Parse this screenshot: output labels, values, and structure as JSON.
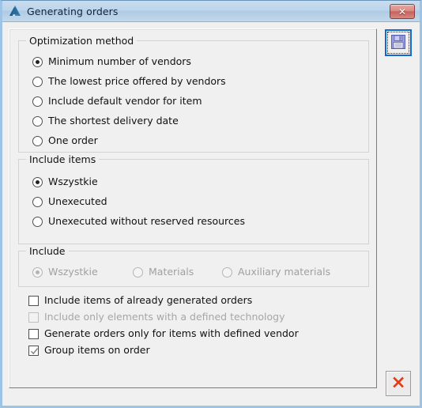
{
  "window": {
    "title": "Generating orders",
    "icon": "mountain-triangle-icon",
    "close_label": "✕",
    "accent_color": "#1367cf",
    "titlebar_color": "#bcd5ea",
    "close_button_color": "#c4635c"
  },
  "groups": {
    "optimization": {
      "title": "Optimization method",
      "enabled": true,
      "options": [
        {
          "label": "Minimum number of vendors",
          "checked": true
        },
        {
          "label": "The lowest price offered by vendors",
          "checked": false
        },
        {
          "label": "Include default vendor for item",
          "checked": false
        },
        {
          "label": "The shortest delivery date",
          "checked": false
        },
        {
          "label": "One order",
          "checked": false
        }
      ]
    },
    "include_items": {
      "title": "Include items",
      "enabled": true,
      "options": [
        {
          "label": "Wszystkie",
          "checked": true
        },
        {
          "label": "Unexecuted",
          "checked": false
        },
        {
          "label": "Unexecuted without reserved resources",
          "checked": false
        }
      ]
    },
    "include": {
      "title": "Include",
      "enabled": false,
      "options": [
        {
          "label": "Wszystkie",
          "checked": true
        },
        {
          "label": "Materials",
          "checked": false
        },
        {
          "label": "Auxiliary materials",
          "checked": false
        }
      ]
    }
  },
  "checkboxes": [
    {
      "label": "Include items of already generated orders",
      "checked": false,
      "enabled": true
    },
    {
      "label": "Include only elements with a defined technology",
      "checked": false,
      "enabled": false
    },
    {
      "label": "Generate orders only for items with defined vendor",
      "checked": false,
      "enabled": true
    },
    {
      "label": "Group items on order",
      "checked": true,
      "enabled": true
    }
  ],
  "toolbar": {
    "save": {
      "name": "save-icon",
      "tooltip": "Save"
    },
    "cancel": {
      "name": "cancel-icon",
      "tooltip": "Cancel"
    }
  }
}
